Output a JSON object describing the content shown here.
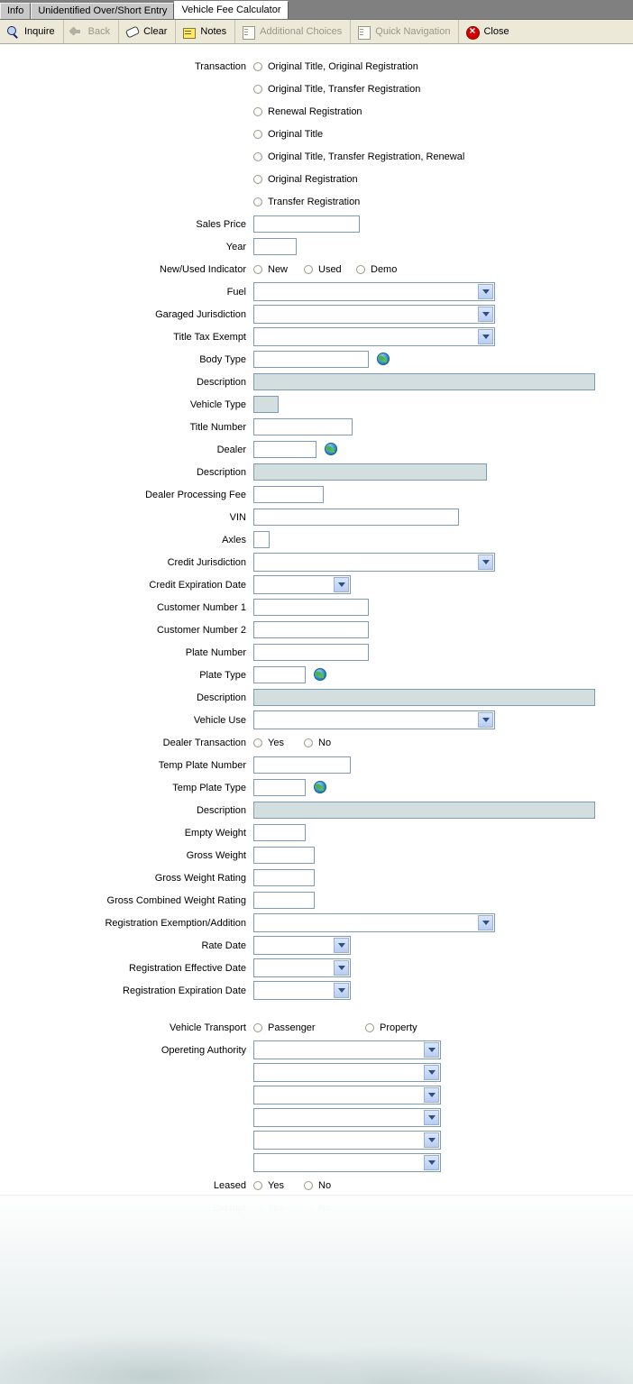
{
  "window": {
    "tabs": [
      {
        "label": "Info",
        "active": false
      },
      {
        "label": "Unidentified Over/Short Entry",
        "active": false
      },
      {
        "label": "Vehicle Fee Calculator",
        "active": true
      }
    ]
  },
  "toolbar": {
    "items": [
      {
        "label": "Inquire",
        "icon": "search-icon",
        "disabled": false
      },
      {
        "label": "Back",
        "icon": "back-arrow-icon",
        "disabled": true
      },
      {
        "label": "Clear",
        "icon": "eraser-icon",
        "disabled": false
      },
      {
        "label": "Notes",
        "icon": "notes-icon",
        "disabled": false
      },
      {
        "label": "Additional Choices",
        "icon": "list-grid-icon",
        "disabled": true
      },
      {
        "label": "Quick Navigation",
        "icon": "list-grid-icon",
        "disabled": true
      },
      {
        "label": "Close",
        "icon": "close-icon",
        "disabled": false
      }
    ]
  },
  "form": {
    "transaction": {
      "label": "Transaction",
      "options": [
        "Original Title, Original Registration",
        "Original Title, Transfer Registration",
        "Renewal Registration",
        "Original Title",
        "Original Title, Transfer Registration, Renewal",
        "Original Registration",
        "Transfer Registration"
      ],
      "selected": ""
    },
    "sales_price": {
      "label": "Sales Price",
      "value": ""
    },
    "year": {
      "label": "Year",
      "value": ""
    },
    "new_used_indicator": {
      "label": "New/Used Indicator",
      "options": [
        "New",
        "Used",
        "Demo"
      ],
      "selected": ""
    },
    "fuel": {
      "label": "Fuel",
      "value": ""
    },
    "garaged_jurisdiction": {
      "label": "Garaged Jurisdiction",
      "value": ""
    },
    "title_tax_exempt": {
      "label": "Title Tax Exempt",
      "value": ""
    },
    "body_type": {
      "label": "Body Type",
      "value": ""
    },
    "body_type_description": {
      "label": "Description",
      "value": ""
    },
    "vehicle_type": {
      "label": "Vehicle Type",
      "value": ""
    },
    "title_number": {
      "label": "Title Number",
      "value": ""
    },
    "dealer": {
      "label": "Dealer",
      "value": ""
    },
    "dealer_description": {
      "label": "Description",
      "value": ""
    },
    "dealer_processing_fee": {
      "label": "Dealer Processing Fee",
      "value": ""
    },
    "vin": {
      "label": "VIN",
      "value": ""
    },
    "axles": {
      "label": "Axles",
      "value": ""
    },
    "credit_jurisdiction": {
      "label": "Credit Jurisdiction",
      "value": ""
    },
    "credit_expiration_date": {
      "label": "Credit Expiration Date",
      "value": ""
    },
    "customer_number_1": {
      "label": "Customer Number 1",
      "value": ""
    },
    "customer_number_2": {
      "label": "Customer Number 2",
      "value": ""
    },
    "plate_number": {
      "label": "Plate Number",
      "value": ""
    },
    "plate_type": {
      "label": "Plate Type",
      "value": ""
    },
    "plate_type_description": {
      "label": "Description",
      "value": ""
    },
    "vehicle_use": {
      "label": "Vehicle Use",
      "value": ""
    },
    "dealer_transaction": {
      "label": "Dealer Transaction",
      "options": [
        "Yes",
        "No"
      ],
      "selected": ""
    },
    "temp_plate_number": {
      "label": "Temp Plate Number",
      "value": ""
    },
    "temp_plate_type": {
      "label": "Temp Plate Type",
      "value": ""
    },
    "temp_plate_description": {
      "label": "Description",
      "value": ""
    },
    "empty_weight": {
      "label": "Empty Weight",
      "value": ""
    },
    "gross_weight": {
      "label": "Gross Weight",
      "value": ""
    },
    "gross_weight_rating": {
      "label": "Gross Weight Rating",
      "value": ""
    },
    "gross_combined_weight_rating": {
      "label": "Gross Combined Weight Rating",
      "value": ""
    },
    "registration_exemption_addition": {
      "label": "Registration Exemption/Addition",
      "value": ""
    },
    "rate_date": {
      "label": "Rate Date",
      "value": ""
    },
    "registration_effective_date": {
      "label": "Registration Effective Date",
      "value": ""
    },
    "registration_expiration_date": {
      "label": "Registration Expiration Date",
      "value": ""
    },
    "vehicle_transport": {
      "label": "Vehicle Transport",
      "options": [
        "Passenger",
        "Property"
      ],
      "selected": ""
    },
    "operating_authority": {
      "label": "Opereting Authority",
      "values": [
        "",
        "",
        "",
        "",
        "",
        ""
      ]
    },
    "leased": {
      "label": "Leased",
      "options": [
        "Yes",
        "No"
      ],
      "selected": ""
    },
    "exempt": {
      "label": "Exempt",
      "options": [
        "Yes",
        "No"
      ],
      "selected": ""
    }
  },
  "colors": {
    "field_border": "#7d9bb5",
    "readonly_bg": "#d3dfdf",
    "toolbar_bg": "#ece9d8",
    "tabstrip_bg": "#808080",
    "dropdown_button": "#b9cdf2"
  }
}
